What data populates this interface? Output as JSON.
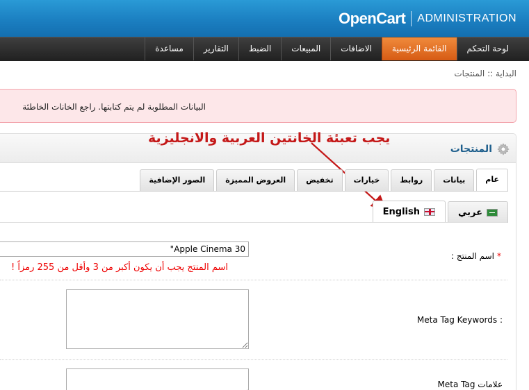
{
  "header": {
    "logo": "OpenCart",
    "subtitle": "ADMINISTRATION"
  },
  "menu": {
    "items": [
      {
        "label": "لوحة التحكم"
      },
      {
        "label": "القائمة الرئيسية",
        "active": true
      },
      {
        "label": "الاضافات"
      },
      {
        "label": "المبيعات"
      },
      {
        "label": "الضبط"
      },
      {
        "label": "التقارير"
      },
      {
        "label": "مساعدة"
      }
    ]
  },
  "breadcrumb": {
    "home": "البداية",
    "separator": " :: ",
    "current": "المنتجات"
  },
  "warning": {
    "text": "البيانات المطلوبة لم يتم كتابتها. راجع الخانات الخاطئة"
  },
  "box": {
    "title": "المنتجات"
  },
  "annotation": {
    "text": "يجب تعبئة الخانتين العربية والانجليزية",
    "color": "#c41818"
  },
  "tabs": [
    {
      "label": "عام",
      "active": true
    },
    {
      "label": "بيانات"
    },
    {
      "label": "روابط"
    },
    {
      "label": "خيارات"
    },
    {
      "label": "تخفيض"
    },
    {
      "label": "العروض المميزة"
    },
    {
      "label": "الصور الإضافية"
    }
  ],
  "language_tabs": [
    {
      "label": "عربي",
      "flag": "flag-sa"
    },
    {
      "label": "English",
      "flag": "flag-gb",
      "active": true
    }
  ],
  "form": {
    "name": {
      "required_mark": "*",
      "label": "اسم المنتج :",
      "value": "Apple Cinema 30\"",
      "error": "اسم المنتج يجب أن يكون أكبر من 3 وأقل من 255 رمزاً !"
    },
    "keywords": {
      "label": "Meta Tag Keywords :"
    },
    "description": {
      "label": "علامات Meta Tag"
    }
  },
  "colors": {
    "header_blue": "#1a7dbf",
    "menu_active": "#e06a20",
    "title_blue": "#1d5e8c",
    "error_red": "#e00000",
    "warning_bg": "#fde7e9"
  }
}
